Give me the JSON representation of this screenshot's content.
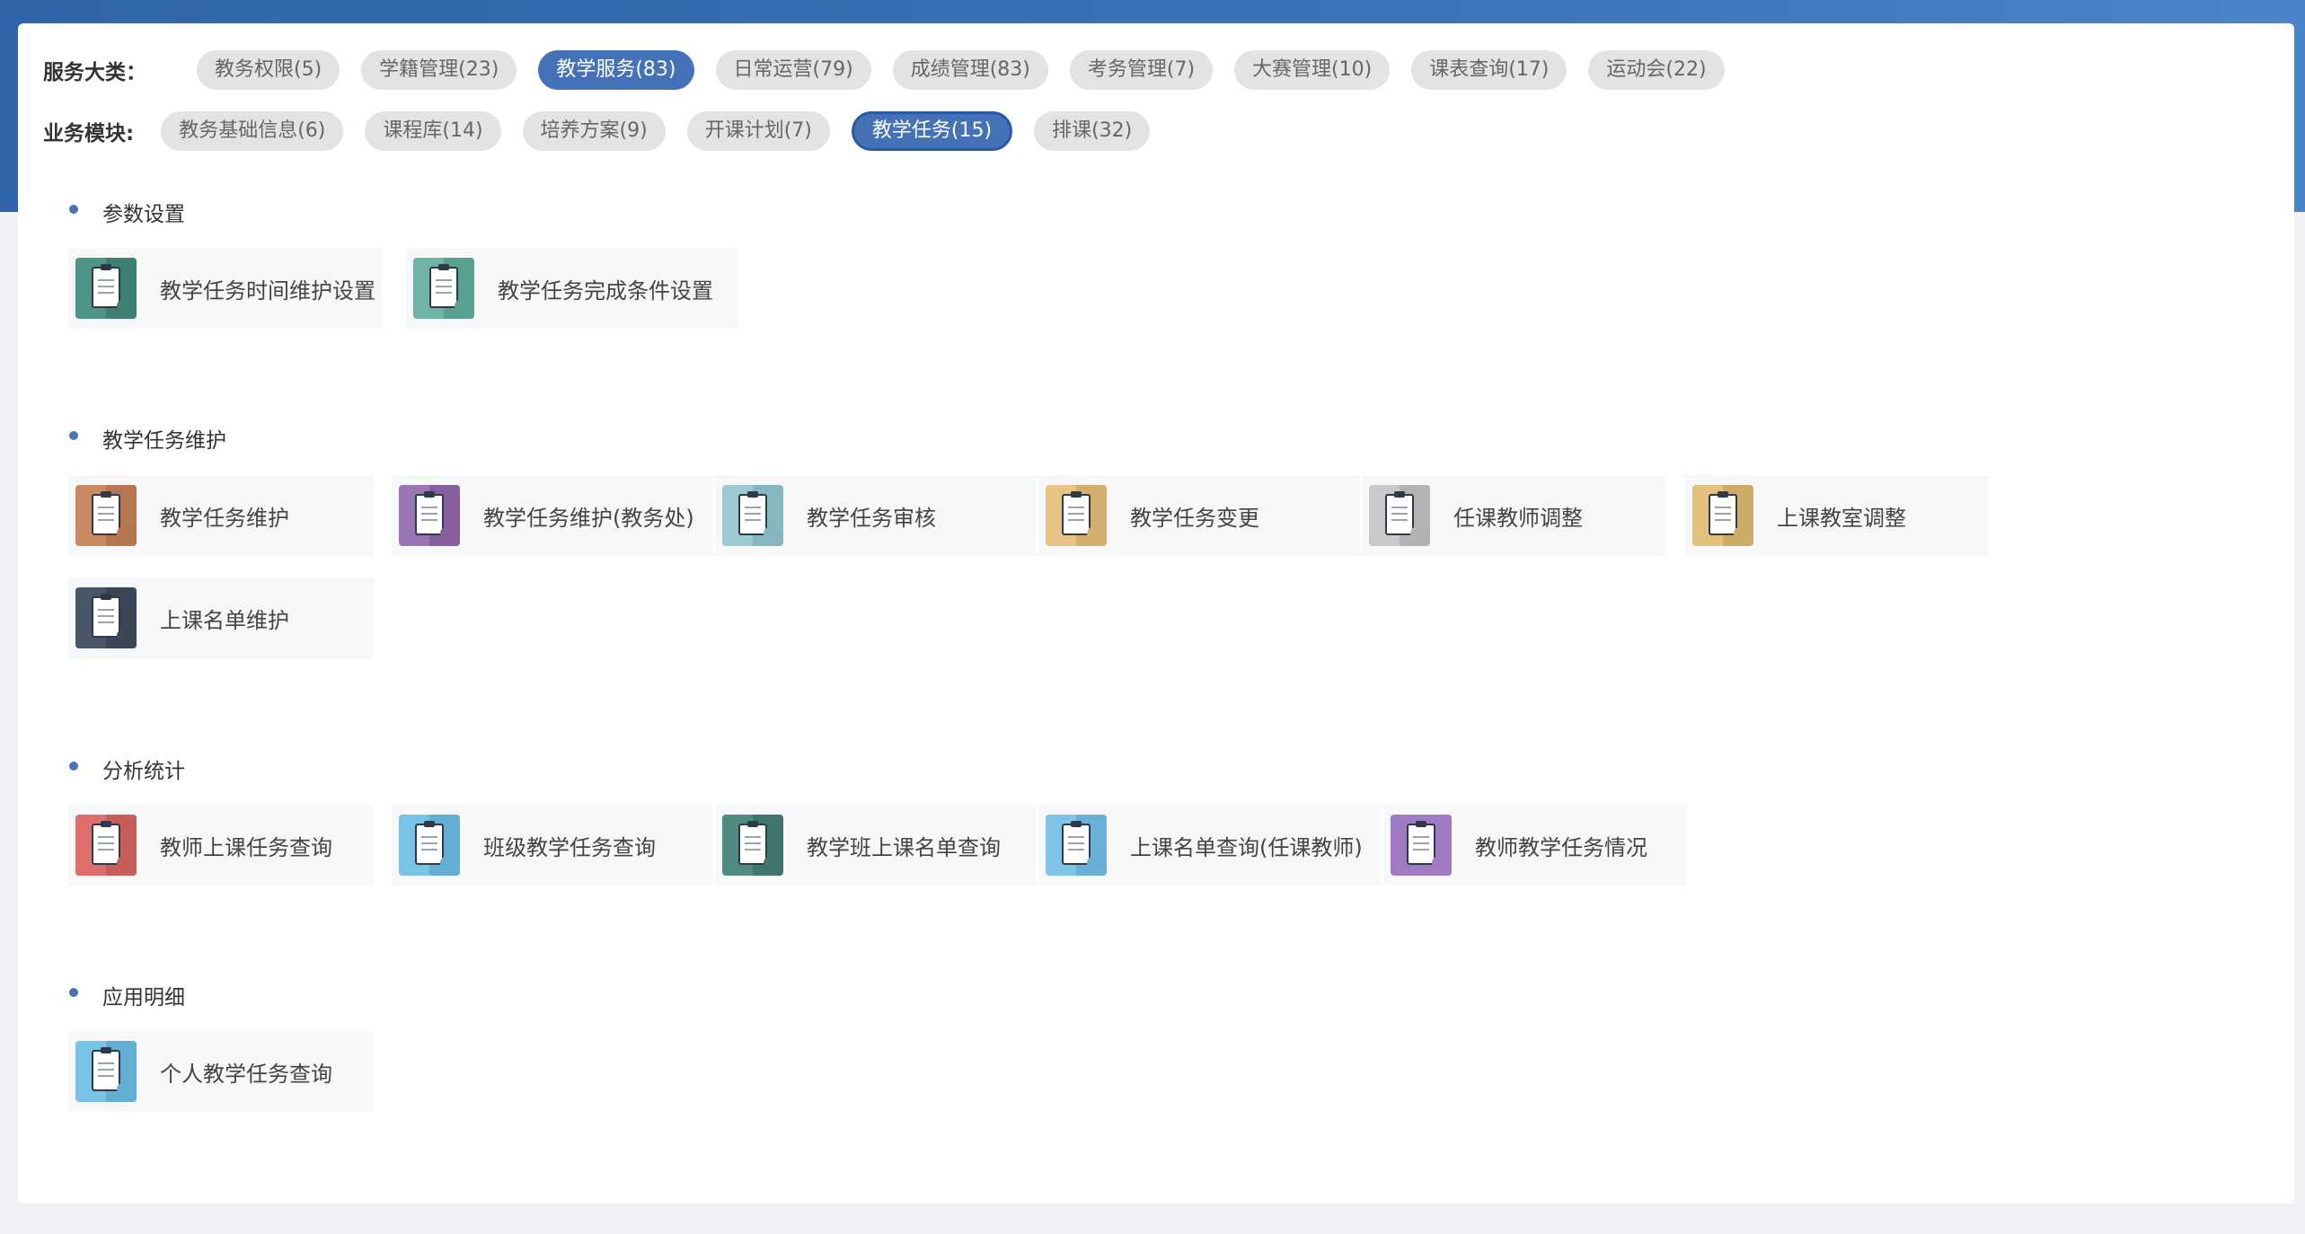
{
  "filters": {
    "service_category_label": "服务大类：",
    "business_module_label": "业务模块:",
    "service_categories": [
      {
        "label": "教务权限(5)",
        "active": false
      },
      {
        "label": "学籍管理(23)",
        "active": false
      },
      {
        "label": "教学服务(83)",
        "active": true
      },
      {
        "label": "日常运营(79)",
        "active": false
      },
      {
        "label": "成绩管理(83)",
        "active": false
      },
      {
        "label": "考务管理(7)",
        "active": false
      },
      {
        "label": "大赛管理(10)",
        "active": false
      },
      {
        "label": "课表查询(17)",
        "active": false
      },
      {
        "label": "运动会(22)",
        "active": false
      }
    ],
    "business_modules": [
      {
        "label": "教务基础信息(6)",
        "active": false
      },
      {
        "label": "课程库(14)",
        "active": false
      },
      {
        "label": "培养方案(9)",
        "active": false
      },
      {
        "label": "开课计划(7)",
        "active": false
      },
      {
        "label": "教学任务(15)",
        "active": true
      },
      {
        "label": "排课(32)",
        "active": false
      }
    ]
  },
  "sections": [
    {
      "title": "参数设置",
      "items": [
        {
          "label": "教学任务时间维护设置",
          "icon": "clock-clipboard-icon",
          "color": "#4e9487",
          "color2": "#3f7f73"
        },
        {
          "label": "教学任务完成条件设置",
          "icon": "check-clipboard-icon",
          "color": "#6fb3a4",
          "color2": "#5aa090"
        }
      ]
    },
    {
      "title": "教学任务维护",
      "items": [
        {
          "label": "教学任务维护",
          "icon": "wrench-clipboard-icon",
          "color": "#c98a63",
          "color2": "#b57650"
        },
        {
          "label": "教学任务维护(教务处)",
          "icon": "wrench-clipboard-icon",
          "color": "#9b74b3",
          "color2": "#86609e"
        },
        {
          "label": "教学任务审核",
          "icon": "approve-clipboard-icon",
          "color": "#9ecad3",
          "color2": "#86b6c0"
        },
        {
          "label": "教学任务变更",
          "icon": "edit-clipboard-icon",
          "color": "#e8c383",
          "color2": "#d4ae6c"
        },
        {
          "label": "任课教师调整",
          "icon": "teacher-book-icon",
          "color": "#c9c9c9",
          "color2": "#b3b3b3"
        },
        {
          "label": "上课教室调整",
          "icon": "edit-clipboard-icon",
          "color": "#e3c07c",
          "color2": "#cfab66"
        },
        {
          "label": "上课名单维护",
          "icon": "tools-clipboard-icon",
          "color": "#4a5668",
          "color2": "#3b4656"
        }
      ]
    },
    {
      "title": "分析统计",
      "items": [
        {
          "label": "教师上课任务查询",
          "icon": "teacher-card-icon",
          "color": "#dd6e6b",
          "color2": "#c85e5b"
        },
        {
          "label": "班级教学任务查询",
          "icon": "search-clipboard-icon",
          "color": "#79c3e6",
          "color2": "#63afd3"
        },
        {
          "label": "教学班上课名单查询",
          "icon": "class-list-icon",
          "color": "#4f8a80",
          "color2": "#40766d"
        },
        {
          "label": "上课名单查询(任课教师)",
          "icon": "hanging-board-icon",
          "color": "#7fc3e8",
          "color2": "#69afd6"
        },
        {
          "label": "教师教学任务情况",
          "icon": "report-icon",
          "color": "#a07ac2",
          "color2": "#a07ac2"
        }
      ]
    },
    {
      "title": "应用明细",
      "items": [
        {
          "label": "个人教学任务查询",
          "icon": "search-clipboard-icon",
          "color": "#79c3e6",
          "color2": "#63afd3"
        }
      ]
    }
  ]
}
